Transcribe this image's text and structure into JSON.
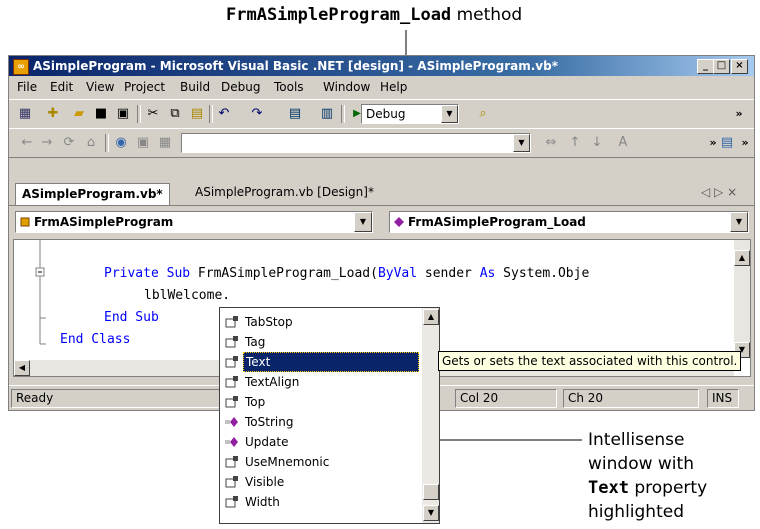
{
  "annotations": {
    "top": {
      "code": "FrmASimpleProgram_Load",
      "text": " method"
    },
    "bottom": {
      "line1": "Intellisense",
      "line2": "window with",
      "line3_code": "Text",
      "line3_text": " property",
      "line4": "highlighted"
    }
  },
  "window": {
    "title": "ASimpleProgram - Microsoft Visual Basic .NET [design] - ASimpleProgram.vb*",
    "controls": [
      "_",
      "□",
      "×"
    ]
  },
  "menu": [
    "File",
    "Edit",
    "View",
    "Project",
    "Build",
    "Debug",
    "Tools",
    "Window",
    "Help"
  ],
  "toolbar": {
    "config": "Debug",
    "overflow": "»"
  },
  "tabs": {
    "active": "ASimpleProgram.vb*",
    "other": "ASimpleProgram.vb [Design]*",
    "nav": "◁ ▷ ×"
  },
  "nav": {
    "class_combo": "FrmASimpleProgram",
    "method_combo": "FrmASimpleProgram_Load"
  },
  "code": {
    "line1_kw1": "Private Sub",
    "line1_rest1": " FrmASimpleProgram_Load(",
    "line1_kw2": "ByVal",
    "line1_rest2": " sender ",
    "line1_kw3": "As",
    "line1_rest3": " System.Obje",
    "line2": "lblWelcome.",
    "line3": "End Sub",
    "line4": "End Class"
  },
  "status": {
    "state": "Ready",
    "col": "Col 20",
    "ch": "Ch 20",
    "mode": "INS"
  },
  "intellisense": {
    "items": [
      {
        "label": "TabStop",
        "kind": "property"
      },
      {
        "label": "Tag",
        "kind": "property"
      },
      {
        "label": "Text",
        "kind": "property",
        "selected": true
      },
      {
        "label": "TextAlign",
        "kind": "property"
      },
      {
        "label": "Top",
        "kind": "property"
      },
      {
        "label": "ToString",
        "kind": "method"
      },
      {
        "label": "Update",
        "kind": "method"
      },
      {
        "label": "UseMnemonic",
        "kind": "property"
      },
      {
        "label": "Visible",
        "kind": "property"
      },
      {
        "label": "Width",
        "kind": "property"
      }
    ],
    "tooltip": "Gets or sets the text associated with this control."
  }
}
